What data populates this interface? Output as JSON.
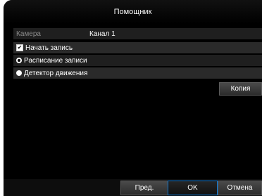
{
  "dialog": {
    "title": "Помощник"
  },
  "camera": {
    "label": "Камера",
    "value": "Канал 1"
  },
  "options": {
    "start_recording": {
      "label": "Начать запись",
      "checked": true
    },
    "schedule": {
      "label": "Расписание записи",
      "selected": true
    },
    "motion": {
      "label": "Детектор движения",
      "selected": false
    }
  },
  "buttons": {
    "copy": "Копия",
    "prev": "Пред.",
    "ok": "OK",
    "cancel": "Отмена"
  },
  "colors": {
    "background": "#000000",
    "accent": "#0a78d6"
  }
}
